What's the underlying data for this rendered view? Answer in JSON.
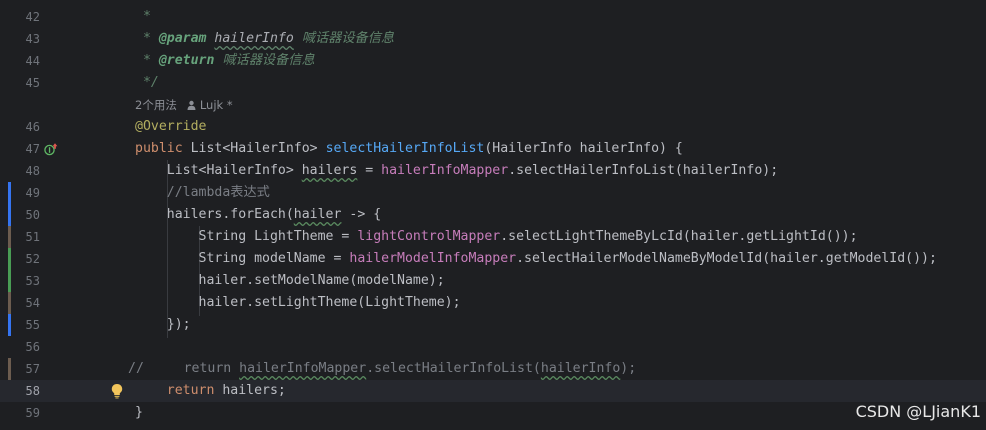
{
  "editor": {
    "lines": {
      "l42": {
        "num": "42",
        "t1": " *"
      },
      "l43": {
        "num": "43",
        "t1": " * ",
        "t2": "@param",
        "t3": " ",
        "t4": "hailerInfo",
        "t5": " 喊话器设备信息"
      },
      "l44": {
        "num": "44",
        "t1": " * ",
        "t2": "@return",
        "t3": " 喊话器设备信息"
      },
      "l45": {
        "num": "45",
        "t1": " */"
      },
      "usages": {
        "count_label": "2个用法",
        "author": "Lujk *"
      },
      "l46": {
        "num": "46",
        "t1": "@Override"
      },
      "l47": {
        "num": "47",
        "t1": "public",
        "t2": " List<HailerInfo> ",
        "t3": "selectHailerInfoList",
        "t4": "(HailerInfo hailerInfo) {"
      },
      "l48": {
        "num": "48",
        "t1": "    List<HailerInfo> ",
        "t2": "hailers",
        "t3": " = ",
        "t4": "hailerInfoMapper",
        "t5": ".selectHailerInfoList(hailerInfo);"
      },
      "l49": {
        "num": "49",
        "t1": "    //lambda表达式"
      },
      "l50": {
        "num": "50",
        "t1": "    hailers.forEach(",
        "t2": "hailer",
        "t3": " -> {"
      },
      "l51": {
        "num": "51",
        "t1": "        String LightTheme = ",
        "t2": "lightControlMapper",
        "t3": ".selectLightThemeByLcId(hailer.getLightId());"
      },
      "l52": {
        "num": "52",
        "t1": "        String modelName = ",
        "t2": "hailerModelInfoMapper",
        "t3": ".selectHailerModelNameByModelId(hailer.getModelId());"
      },
      "l53": {
        "num": "53",
        "t1": "        hailer.setModelName(modelName);"
      },
      "l54": {
        "num": "54",
        "t1": "        hailer.setLightTheme(LightTheme);"
      },
      "l55": {
        "num": "55",
        "t1": "    });"
      },
      "l56": {
        "num": "56"
      },
      "l57": {
        "num": "57",
        "t1": "//     return ",
        "t2": "hailerInfoMapper",
        "t3": ".selectHailerInfoList(",
        "t4": "hailerInfo",
        "t5": ");"
      },
      "l58": {
        "num": "58",
        "t1": "    ",
        "t2": "return",
        "t3": " hailers;"
      },
      "l59": {
        "num": "59",
        "t1": "}"
      }
    },
    "colors": {
      "background": "#1e1f22",
      "keyword": "#cf8e6d",
      "method_decl": "#56a8f5",
      "field": "#c77dbb",
      "annotation": "#b3ae60",
      "doc_comment": "#5f826b",
      "line_comment": "#7a7e85",
      "vcs_modified": "#3574f0",
      "vcs_added": "#499c54"
    },
    "icons": {
      "implements_marker": "override-implements-icon",
      "intention": "lightbulb-icon",
      "author": "person-icon"
    }
  },
  "watermark": {
    "text": "CSDN @LJianK1"
  }
}
